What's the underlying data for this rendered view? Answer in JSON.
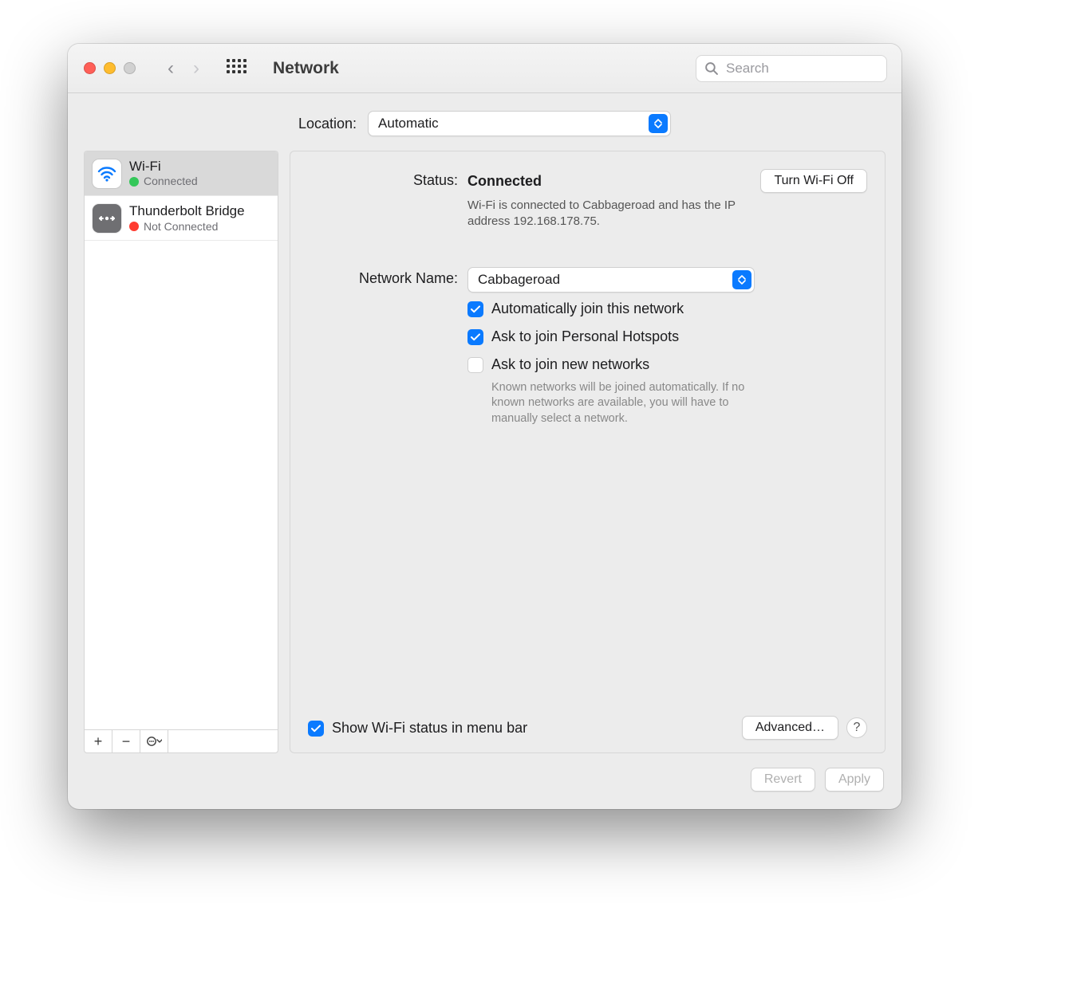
{
  "titlebar": {
    "title": "Network",
    "search_placeholder": "Search"
  },
  "location": {
    "label": "Location:",
    "selected": "Automatic"
  },
  "sidebar": {
    "items": [
      {
        "name": "Wi-Fi",
        "status": "Connected",
        "status_color": "green",
        "selected": true
      },
      {
        "name": "Thunderbolt Bridge",
        "status": "Not Connected",
        "status_color": "red",
        "selected": false
      }
    ],
    "toolbar": {
      "add": "+",
      "remove": "−",
      "menu": "⊙"
    }
  },
  "detail": {
    "status_label": "Status:",
    "status_value": "Connected",
    "status_desc": "Wi-Fi is connected to Cabbageroad and has the IP address 192.168.178.75.",
    "toggle_label": "Turn Wi-Fi Off",
    "network_name_label": "Network Name:",
    "network_name_value": "Cabbageroad",
    "check_auto_join": "Automatically join this network",
    "check_hotspots": "Ask to join Personal Hotspots",
    "check_new_networks": "Ask to join new networks",
    "check_new_networks_help": "Known networks will be joined automatically. If no known networks are available, you will have to manually select a network.",
    "show_menubar": "Show Wi-Fi status in menu bar",
    "advanced": "Advanced…",
    "help": "?"
  },
  "footer": {
    "revert": "Revert",
    "apply": "Apply"
  }
}
